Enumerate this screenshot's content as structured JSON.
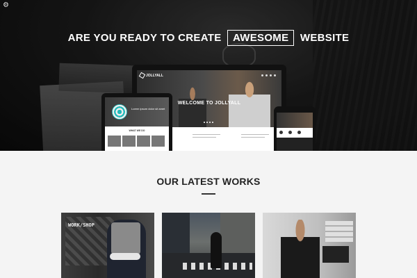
{
  "hero": {
    "title_before": "ARE YOU READY TO CREATE",
    "title_boxed": "AWESOME",
    "title_after": "WEBSITE",
    "settings_icon": "gear-icon"
  },
  "mockup": {
    "brand": "JOLLYALL",
    "welcome": "WELCOME TO JOLLYALL",
    "tablet_text": "Lorem ipsum dolor sit amet",
    "tablet_section": "WHAT WE DO"
  },
  "works": {
    "title": "OUR LATEST WORKS",
    "items": [
      {
        "label": "work/shop"
      },
      {
        "label": "street crossing"
      },
      {
        "label": "office"
      }
    ]
  }
}
